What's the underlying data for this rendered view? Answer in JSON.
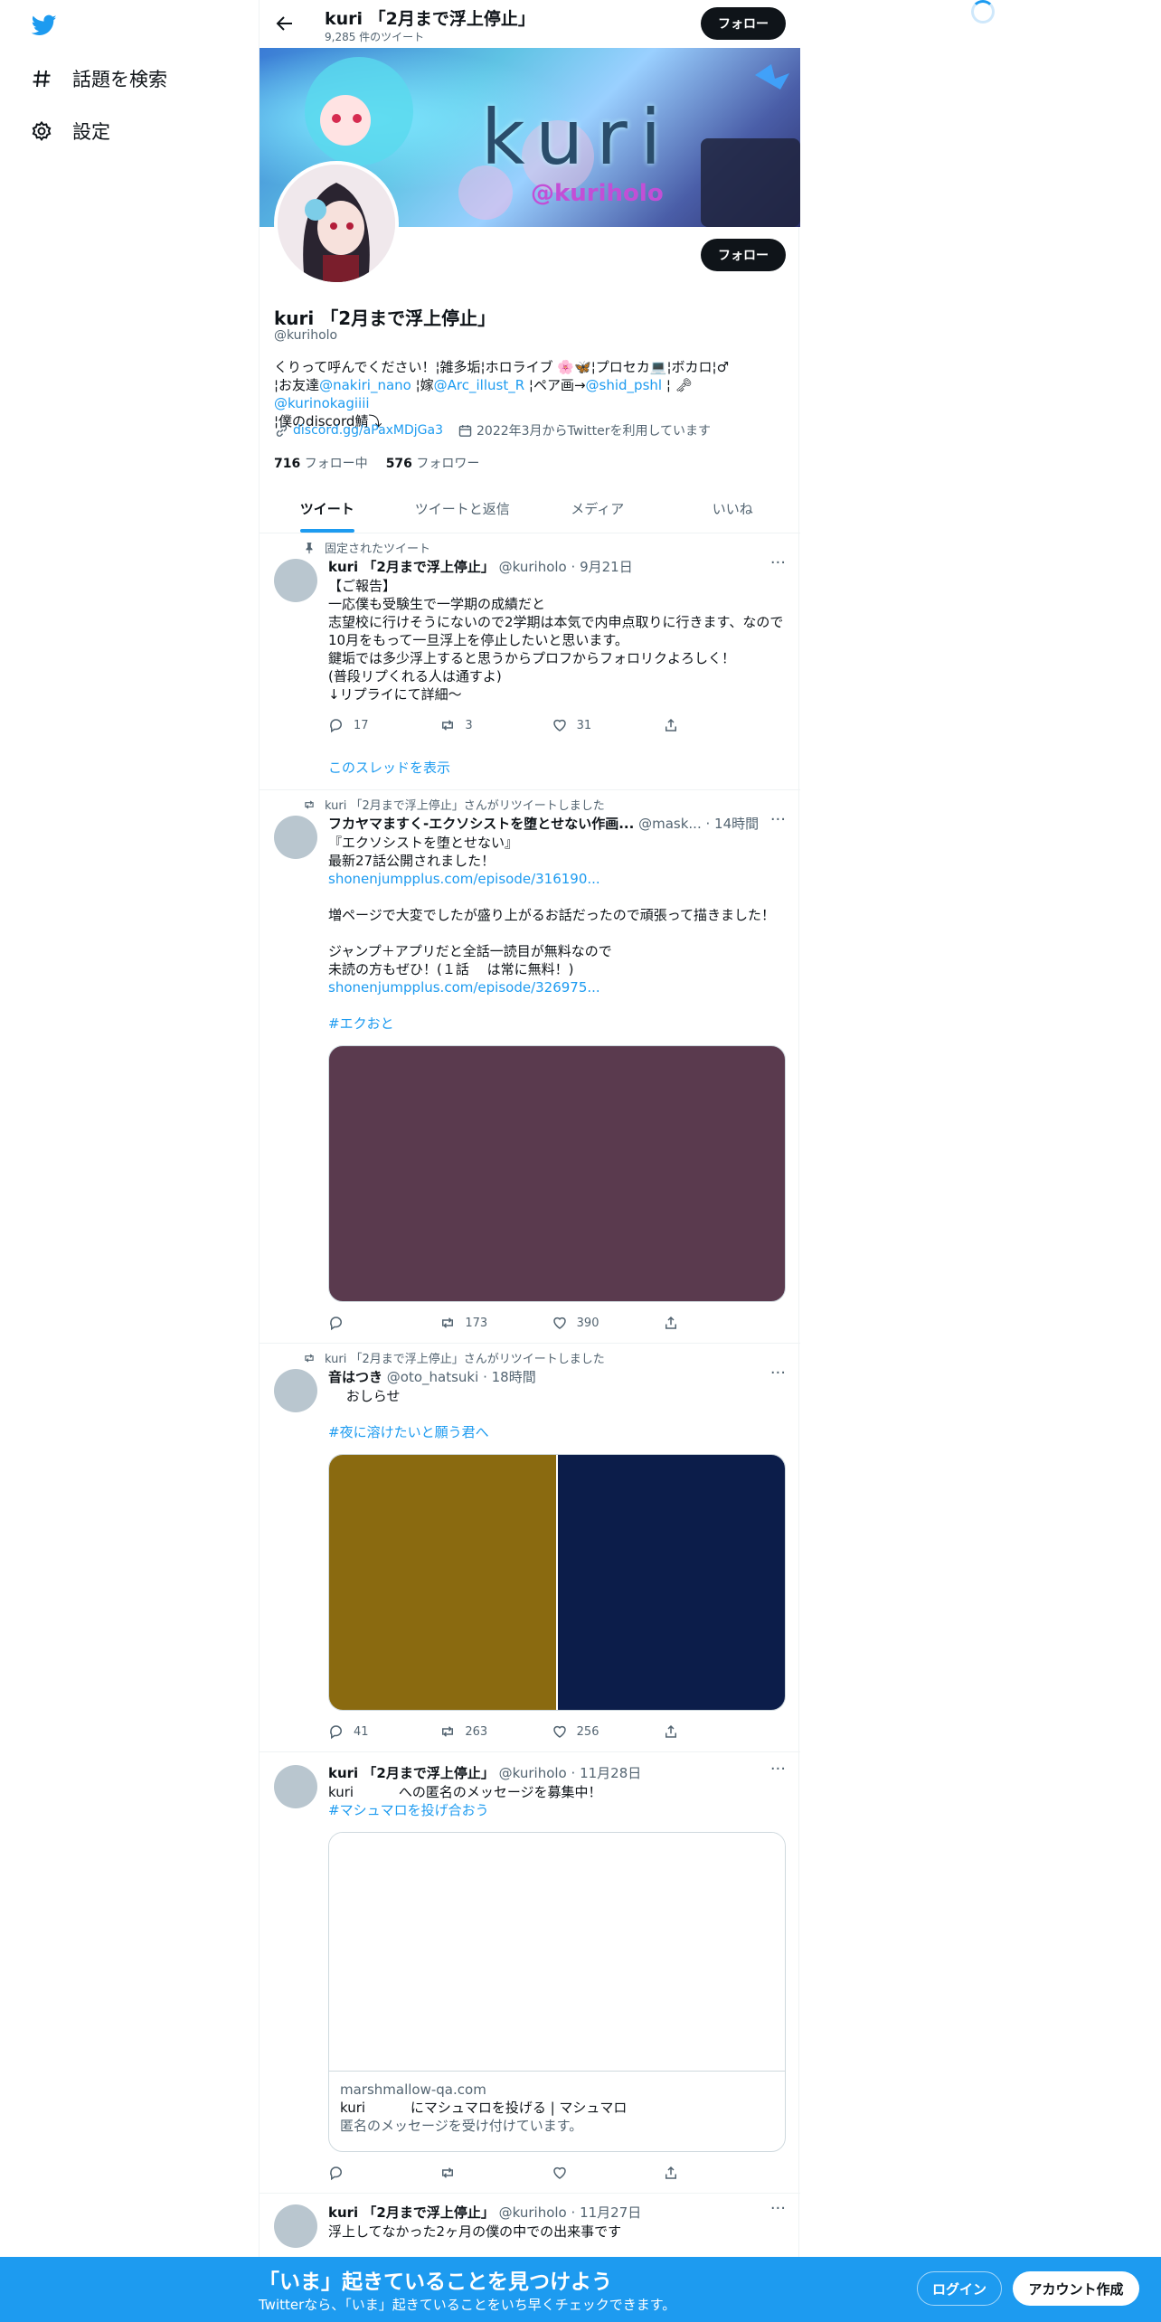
{
  "sidebar": {
    "logo_icon": "twitter-bird-icon",
    "explore_label": "話題を検索",
    "settings_label": "設定"
  },
  "header": {
    "title": "kuri 「2月まで浮上停止」",
    "tweet_count": "9,285 件のツイート",
    "follow_label": "フォロー"
  },
  "banner": {
    "text_large": "kuri",
    "text_handle": "@kuriholo"
  },
  "profile": {
    "name": "kuri 「2月まで浮上停止」",
    "handle": "@kuriholo",
    "follow_label": "フォロー",
    "bio_line1": "くりって呼んでください！¦雑多垢¦ホロライブ 🌸🦋¦プロセカ💻¦ボカロ¦♂",
    "bio_line2a": "¦お友達",
    "bio_link1": "@nakiri_nano",
    "bio_line2b": " ¦嫁",
    "bio_link2": "@Arc_illust_R",
    "bio_line2c": " ¦ペア画→",
    "bio_link3": "@shid_pshl",
    "bio_line2d": " ¦ 🗝 ",
    "bio_link4": "@kurinokagiiii",
    "bio_line3": "¦僕のdiscord鯖⤵︎",
    "website": "discord.gg/aPaxMDjGa3",
    "joined": "2022年3月からTwitterを利用しています",
    "following_count": "716",
    "following_label": "フォロー中",
    "followers_count": "576",
    "followers_label": "フォロワー"
  },
  "tabs": [
    "ツイート",
    "ツイートと返信",
    "メディア",
    "いいね"
  ],
  "tweets": [
    {
      "context": "固定されたツイート",
      "name": "kuri 「2月まで浮上停止」",
      "handle": "@kuriholo",
      "time": "9月21日",
      "text": "【ご報告】\n一応僕も受験生で一学期の成績だと\n志望校に行けそうにないので2学期は本気で内申点取りに行きます、なので\n10月をもって一旦浮上を停止したいと思います。\n鍵垢では多少浮上すると思うからプロフからフォロリクよろしく！\n(普段リプくれる人は通すよ)\n↓リプライにて詳細〜",
      "replies": "17",
      "retweets": "3",
      "likes": "31",
      "thread": "このスレッドを表示"
    },
    {
      "context": "kuri 「2月まで浮上停止」さんがリツイートしました",
      "name": "フカヤマますく-エクソシストを堕とせない作画...",
      "handle": "@mask...",
      "time": "14時間",
      "text1": "『エクソシストを堕とせない』\n最新27話公開されました！",
      "link1": "shonenjumpplus.com/episode/316190...",
      "text2": "増ページで大変でしたが盛り上がるお話だったので頑張って描きました！\n\nジャンプ＋アプリだと全話一読目が無料なので\n未読の方もぜひ！(１話　 は常に無料！)",
      "link2": "shonenjumpplus.com/episode/326975...",
      "hashtag": "#エクおと",
      "replies": "",
      "retweets": "173",
      "likes": "390",
      "media_color": "#5a3a4e"
    },
    {
      "context": "kuri 「2月まで浮上停止」さんがリツイートしました",
      "name": "音はつき",
      "handle": "@oto_hatsuki",
      "time": "18時間",
      "text": "　 おしらせ",
      "hashtag": "#夜に溶けたいと願う君へ",
      "replies": "41",
      "retweets": "263",
      "likes": "256",
      "media_left_color": "#8a6a10",
      "media_right_color": "#0c1d4a"
    },
    {
      "context": "",
      "name": "kuri 「2月まで浮上停止」",
      "handle": "@kuriholo",
      "time": "11月28日",
      "text": "kuri　　　 への匿名のメッセージを募集中！",
      "hashtag": "#マシュマロを投げ合おう",
      "card_domain": "marshmallow-qa.com",
      "card_title": "kuri　　　 にマシュマロを投げる | マシュマロ",
      "card_desc": "匿名のメッセージを受け付けています。",
      "replies": "",
      "retweets": "",
      "likes": ""
    },
    {
      "context": "",
      "name": "kuri 「2月まで浮上停止」",
      "handle": "@kuriholo",
      "time": "11月27日",
      "text": "浮上してなかった2ヶ月の僕の中での出来事です"
    }
  ],
  "bottom": {
    "headline": "「いま」起きていることを見つけよう",
    "sub": "Twitterなら、「いま」起きていることをいち早くチェックできます。",
    "login": "ログイン",
    "signup": "アカウント作成"
  },
  "colors": {
    "accent": "#1d9bf0",
    "text": "#0f1419",
    "muted": "#536471"
  }
}
